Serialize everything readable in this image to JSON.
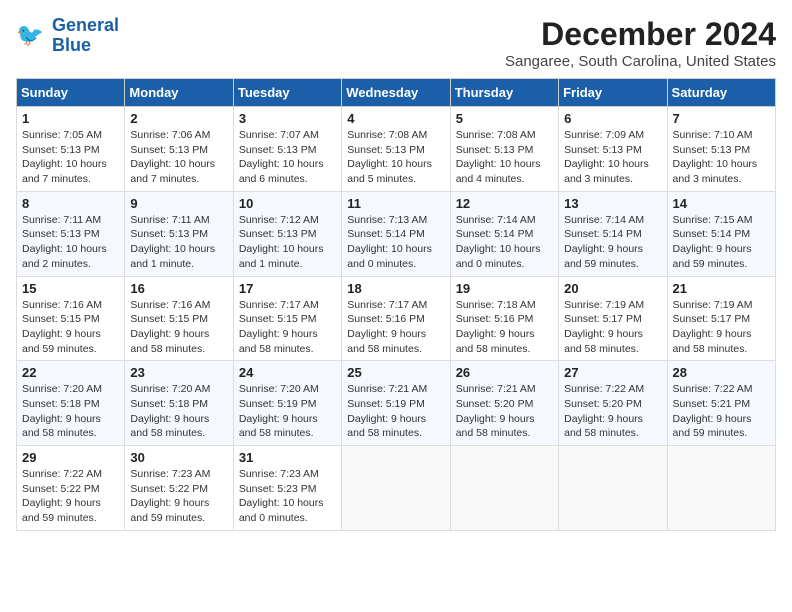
{
  "logo": {
    "line1": "General",
    "line2": "Blue"
  },
  "title": "December 2024",
  "location": "Sangaree, South Carolina, United States",
  "days_of_week": [
    "Sunday",
    "Monday",
    "Tuesday",
    "Wednesday",
    "Thursday",
    "Friday",
    "Saturday"
  ],
  "weeks": [
    [
      {
        "day": "1",
        "sunrise": "7:05 AM",
        "sunset": "5:13 PM",
        "daylight": "10 hours and 7 minutes."
      },
      {
        "day": "2",
        "sunrise": "7:06 AM",
        "sunset": "5:13 PM",
        "daylight": "10 hours and 7 minutes."
      },
      {
        "day": "3",
        "sunrise": "7:07 AM",
        "sunset": "5:13 PM",
        "daylight": "10 hours and 6 minutes."
      },
      {
        "day": "4",
        "sunrise": "7:08 AM",
        "sunset": "5:13 PM",
        "daylight": "10 hours and 5 minutes."
      },
      {
        "day": "5",
        "sunrise": "7:08 AM",
        "sunset": "5:13 PM",
        "daylight": "10 hours and 4 minutes."
      },
      {
        "day": "6",
        "sunrise": "7:09 AM",
        "sunset": "5:13 PM",
        "daylight": "10 hours and 3 minutes."
      },
      {
        "day": "7",
        "sunrise": "7:10 AM",
        "sunset": "5:13 PM",
        "daylight": "10 hours and 3 minutes."
      }
    ],
    [
      {
        "day": "8",
        "sunrise": "7:11 AM",
        "sunset": "5:13 PM",
        "daylight": "10 hours and 2 minutes."
      },
      {
        "day": "9",
        "sunrise": "7:11 AM",
        "sunset": "5:13 PM",
        "daylight": "10 hours and 1 minute."
      },
      {
        "day": "10",
        "sunrise": "7:12 AM",
        "sunset": "5:13 PM",
        "daylight": "10 hours and 1 minute."
      },
      {
        "day": "11",
        "sunrise": "7:13 AM",
        "sunset": "5:14 PM",
        "daylight": "10 hours and 0 minutes."
      },
      {
        "day": "12",
        "sunrise": "7:14 AM",
        "sunset": "5:14 PM",
        "daylight": "10 hours and 0 minutes."
      },
      {
        "day": "13",
        "sunrise": "7:14 AM",
        "sunset": "5:14 PM",
        "daylight": "9 hours and 59 minutes."
      },
      {
        "day": "14",
        "sunrise": "7:15 AM",
        "sunset": "5:14 PM",
        "daylight": "9 hours and 59 minutes."
      }
    ],
    [
      {
        "day": "15",
        "sunrise": "7:16 AM",
        "sunset": "5:15 PM",
        "daylight": "9 hours and 59 minutes."
      },
      {
        "day": "16",
        "sunrise": "7:16 AM",
        "sunset": "5:15 PM",
        "daylight": "9 hours and 58 minutes."
      },
      {
        "day": "17",
        "sunrise": "7:17 AM",
        "sunset": "5:15 PM",
        "daylight": "9 hours and 58 minutes."
      },
      {
        "day": "18",
        "sunrise": "7:17 AM",
        "sunset": "5:16 PM",
        "daylight": "9 hours and 58 minutes."
      },
      {
        "day": "19",
        "sunrise": "7:18 AM",
        "sunset": "5:16 PM",
        "daylight": "9 hours and 58 minutes."
      },
      {
        "day": "20",
        "sunrise": "7:19 AM",
        "sunset": "5:17 PM",
        "daylight": "9 hours and 58 minutes."
      },
      {
        "day": "21",
        "sunrise": "7:19 AM",
        "sunset": "5:17 PM",
        "daylight": "9 hours and 58 minutes."
      }
    ],
    [
      {
        "day": "22",
        "sunrise": "7:20 AM",
        "sunset": "5:18 PM",
        "daylight": "9 hours and 58 minutes."
      },
      {
        "day": "23",
        "sunrise": "7:20 AM",
        "sunset": "5:18 PM",
        "daylight": "9 hours and 58 minutes."
      },
      {
        "day": "24",
        "sunrise": "7:20 AM",
        "sunset": "5:19 PM",
        "daylight": "9 hours and 58 minutes."
      },
      {
        "day": "25",
        "sunrise": "7:21 AM",
        "sunset": "5:19 PM",
        "daylight": "9 hours and 58 minutes."
      },
      {
        "day": "26",
        "sunrise": "7:21 AM",
        "sunset": "5:20 PM",
        "daylight": "9 hours and 58 minutes."
      },
      {
        "day": "27",
        "sunrise": "7:22 AM",
        "sunset": "5:20 PM",
        "daylight": "9 hours and 58 minutes."
      },
      {
        "day": "28",
        "sunrise": "7:22 AM",
        "sunset": "5:21 PM",
        "daylight": "9 hours and 59 minutes."
      }
    ],
    [
      {
        "day": "29",
        "sunrise": "7:22 AM",
        "sunset": "5:22 PM",
        "daylight": "9 hours and 59 minutes."
      },
      {
        "day": "30",
        "sunrise": "7:23 AM",
        "sunset": "5:22 PM",
        "daylight": "9 hours and 59 minutes."
      },
      {
        "day": "31",
        "sunrise": "7:23 AM",
        "sunset": "5:23 PM",
        "daylight": "10 hours and 0 minutes."
      },
      null,
      null,
      null,
      null
    ]
  ],
  "labels": {
    "sunrise": "Sunrise:",
    "sunset": "Sunset:",
    "daylight": "Daylight:"
  }
}
